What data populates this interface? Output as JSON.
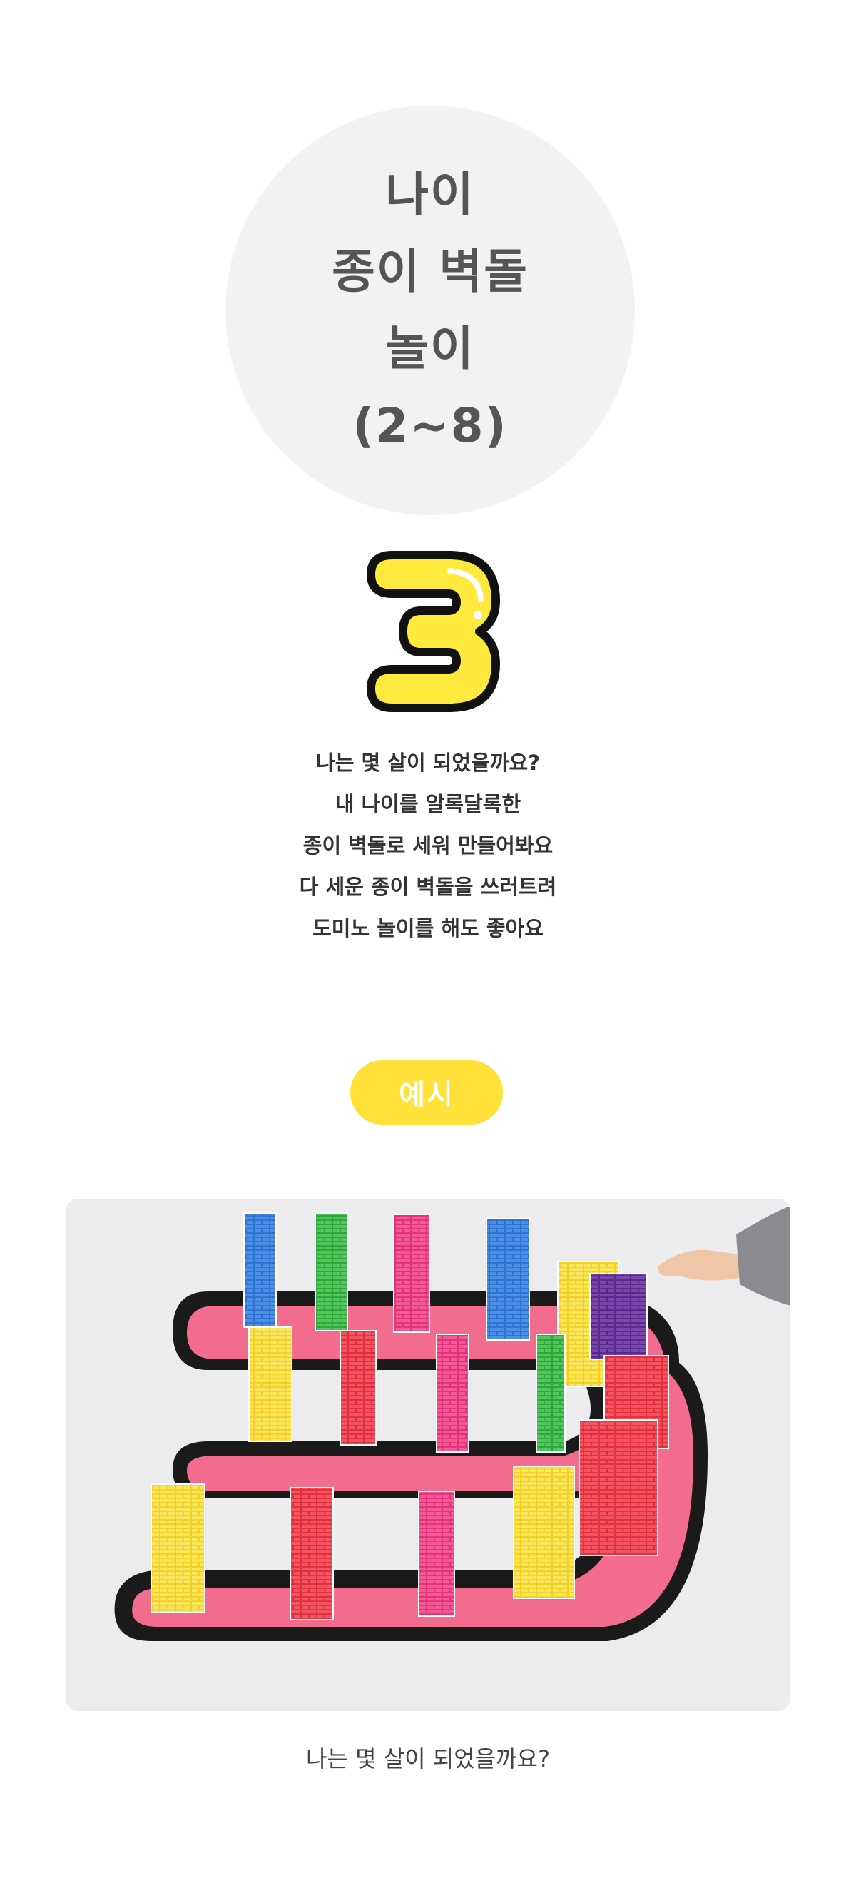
{
  "title": {
    "lines": [
      "나이",
      "종이 벽돌",
      "놀이",
      "(2~8)"
    ]
  },
  "age_number": {
    "value": "3",
    "fill_color": "#ffe93d",
    "outline_color": "#111111"
  },
  "description": {
    "lines": [
      "나는 몇 살이 되었을까요?",
      "내 나이를 알록달록한",
      "종이 벽돌로 세워 만들어봐요",
      "다 세운 종이 벽돌을 쓰러트려",
      "도미노 놀이를 해도 좋아요"
    ]
  },
  "example_badge": {
    "label": "예시",
    "color": "#ffe13a"
  },
  "photo": {
    "description_icon": "paper-brick-number-three-photo"
  },
  "caption": "나는 몇 살이 되었을까요?"
}
